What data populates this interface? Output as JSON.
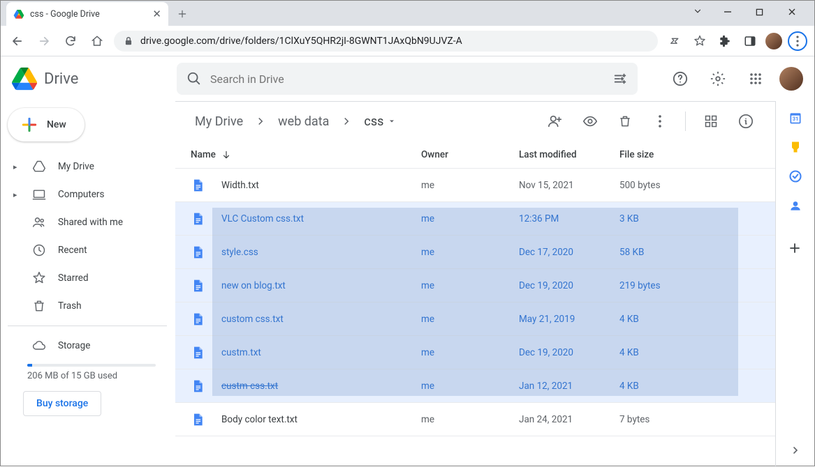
{
  "browser": {
    "tab_title": "css - Google Drive",
    "url": "drive.google.com/drive/folders/1ClXuY5QHR2jI-8GWNT1JAxQbN9UJVZ-A"
  },
  "app": {
    "logo_text": "Drive",
    "search_placeholder": "Search in Drive",
    "new_button": "New"
  },
  "sidebar": {
    "items": [
      {
        "label": "My Drive",
        "icon": "drive",
        "caret": true
      },
      {
        "label": "Computers",
        "icon": "computer",
        "caret": true
      },
      {
        "label": "Shared with me",
        "icon": "people"
      },
      {
        "label": "Recent",
        "icon": "clock"
      },
      {
        "label": "Starred",
        "icon": "star"
      },
      {
        "label": "Trash",
        "icon": "trash"
      }
    ],
    "storage_label": "Storage",
    "storage_used": "206 MB of 15 GB used",
    "buy_label": "Buy storage"
  },
  "breadcrumb": [
    "My Drive",
    "web data",
    "css"
  ],
  "columns": {
    "name": "Name",
    "owner": "Owner",
    "modified": "Last modified",
    "size": "File size"
  },
  "files": [
    {
      "name": "Width.txt",
      "owner": "me",
      "modified": "Nov 15, 2021",
      "size": "500 bytes",
      "selected": false
    },
    {
      "name": "VLC Custom css.txt",
      "owner": "me",
      "modified": "12:36 PM",
      "size": "3 KB",
      "selected": true
    },
    {
      "name": "style.css",
      "owner": "me",
      "modified": "Dec 17, 2020",
      "size": "58 KB",
      "selected": true
    },
    {
      "name": "new on blog.txt",
      "owner": "me",
      "modified": "Dec 19, 2020",
      "size": "219 bytes",
      "selected": true
    },
    {
      "name": "custom css.txt",
      "owner": "me",
      "modified": "May 21, 2019",
      "size": "4 KB",
      "selected": true
    },
    {
      "name": "custm.txt",
      "owner": "me",
      "modified": "Dec 19, 2020",
      "size": "4 KB",
      "selected": true
    },
    {
      "name": "custm css.txt",
      "owner": "me",
      "modified": "Jan 12, 2021",
      "size": "4 KB",
      "selected": true,
      "strike": true
    },
    {
      "name": "Body color text.txt",
      "owner": "me",
      "modified": "Jan 24, 2021",
      "size": "7 bytes",
      "selected": false
    }
  ]
}
